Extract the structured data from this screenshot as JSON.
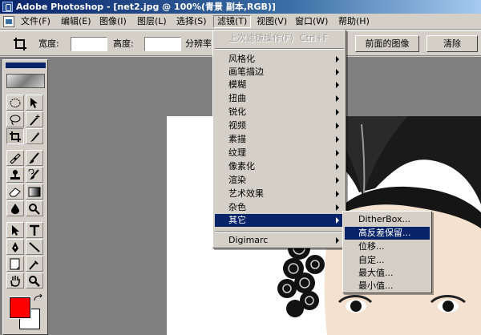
{
  "titlebar": {
    "title": "Adobe Photoshop - [net2.jpg @ 100%(青景 副本,RGB)]"
  },
  "menubar": {
    "items": [
      {
        "label": "文件(F)"
      },
      {
        "label": "编辑(E)"
      },
      {
        "label": "图像(I)"
      },
      {
        "label": "图层(L)"
      },
      {
        "label": "选择(S)"
      },
      {
        "label": "滤镜(T)"
      },
      {
        "label": "视图(V)"
      },
      {
        "label": "窗口(W)"
      },
      {
        "label": "帮助(H)"
      }
    ]
  },
  "options_bar": {
    "width_label": "宽度:",
    "height_label": "高度:",
    "resolution_label": "分辨率",
    "front_image_button": "前面的图像",
    "clear_button": "清除"
  },
  "filter_menu": {
    "last_filter": {
      "label": "上次滤镜操作(F)",
      "shortcut": "Ctrl+F"
    },
    "items": [
      {
        "label": "风格化"
      },
      {
        "label": "画笔描边"
      },
      {
        "label": "模糊"
      },
      {
        "label": "扭曲"
      },
      {
        "label": "锐化"
      },
      {
        "label": "视频"
      },
      {
        "label": "素描"
      },
      {
        "label": "纹理"
      },
      {
        "label": "像素化"
      },
      {
        "label": "渲染"
      },
      {
        "label": "艺术效果"
      },
      {
        "label": "杂色"
      },
      {
        "label": "其它"
      }
    ],
    "digimarc": {
      "label": "Digimarc"
    }
  },
  "other_submenu": {
    "items": [
      {
        "label": "DitherBox..."
      },
      {
        "label": "高反差保留..."
      },
      {
        "label": "位移..."
      },
      {
        "label": "自定..."
      },
      {
        "label": "最大值..."
      },
      {
        "label": "最小值..."
      }
    ]
  },
  "toolbox": {
    "foreground_color": "#ff0000",
    "background_color": "#ffffff"
  },
  "colors": {
    "titlebar_start": "#0a246a",
    "highlight": "#0a246a",
    "workspace": "#808080"
  }
}
